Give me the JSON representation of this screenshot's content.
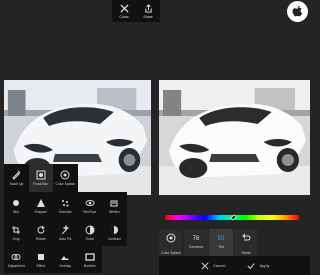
{
  "toolbar": {
    "close_label": "Close",
    "share_label": "Share"
  },
  "brand": {
    "logo": "apple-icon"
  },
  "tools": {
    "row0": [
      {
        "label": "Touch Up",
        "icon": "touch-up-icon",
        "active": false
      },
      {
        "label": "Focal Blur",
        "icon": "focal-blur-icon",
        "active": true
      },
      {
        "label": "Color Splash",
        "icon": "color-splash-icon",
        "active": false
      }
    ],
    "row1": [
      {
        "label": "Blur",
        "icon": "blur-icon"
      },
      {
        "label": "Sharpen",
        "icon": "sharpen-icon"
      },
      {
        "label": "Denoise",
        "icon": "denoise-icon"
      },
      {
        "label": "Red Eye",
        "icon": "red-eye-icon"
      },
      {
        "label": "Whiten",
        "icon": "whiten-icon"
      }
    ],
    "row2": [
      {
        "label": "Crop",
        "icon": "crop-icon"
      },
      {
        "label": "Rotate",
        "icon": "rotate-icon"
      },
      {
        "label": "Auto Fix",
        "icon": "auto-fix-icon"
      },
      {
        "label": "Color",
        "icon": "color-icon"
      },
      {
        "label": "Contrast",
        "icon": "contrast-icon"
      }
    ],
    "row3": [
      {
        "label": "Adjustment",
        "icon": "adjustment-icon"
      },
      {
        "label": "Effect",
        "icon": "effect-icon"
      },
      {
        "label": "Overlay",
        "icon": "overlay-icon"
      },
      {
        "label": "Borders",
        "icon": "borders-icon"
      }
    ]
  },
  "splash_panel": {
    "color_splash_label": "Color Splash",
    "tolerance_value": "78",
    "tolerance_label": "Tolerance",
    "tint_value": "50",
    "tint_label": "Tint",
    "reset_label": "Reset",
    "cancel_label": "Cancel",
    "apply_label": "Apply"
  },
  "colors": {
    "accent": "#2aa0ff",
    "background": "#242424",
    "panel": "#111111"
  }
}
